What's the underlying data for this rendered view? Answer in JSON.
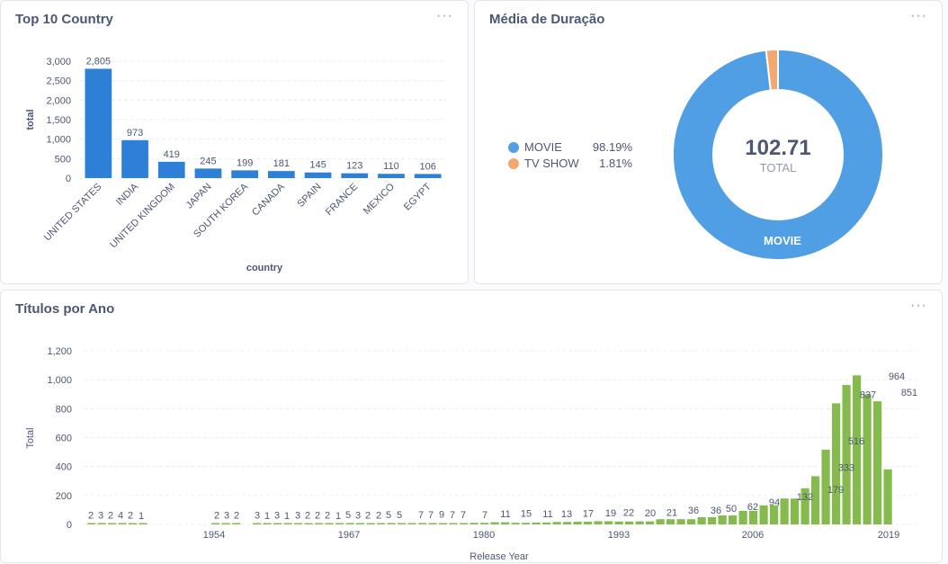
{
  "cards": {
    "top10": {
      "title": "Top 10 Country",
      "menu": "···"
    },
    "duracao": {
      "title": "Média de Duração",
      "menu": "···"
    },
    "titulos": {
      "title": "Títulos por Ano",
      "menu": "···"
    }
  },
  "colors": {
    "bar_blue": "#2e7fd6",
    "bar_green": "#84bb4c",
    "donut_movie": "#509ee3",
    "donut_tv": "#f2a86f"
  },
  "chart_data": [
    {
      "type": "bar",
      "categories": [
        "UNITED STATES",
        "INDIA",
        "UNITED KINGDOM",
        "JAPAN",
        "SOUTH KOREA",
        "CANADA",
        "SPAIN",
        "FRANCE",
        "MEXICO",
        "EGYPT"
      ],
      "values": [
        2805,
        973,
        419,
        245,
        199,
        181,
        145,
        123,
        110,
        106
      ],
      "value_labels": [
        "2,805",
        "973",
        "419",
        "245",
        "199",
        "181",
        "145",
        "123",
        "110",
        "106"
      ],
      "xlabel": "country",
      "ylabel": "total",
      "ylim": [
        0,
        3000
      ],
      "yticks": [
        "0",
        "500",
        "1,000",
        "1,500",
        "2,000",
        "2,500",
        "3,000"
      ],
      "grid": true
    },
    {
      "type": "pie",
      "labels": [
        "MOVIE",
        "TV SHOW"
      ],
      "percent_labels": [
        "98.19%",
        "1.81%"
      ],
      "values": [
        98.19,
        1.81
      ],
      "center_value": "102.71",
      "center_label": "TOTAL",
      "slice_label": "MOVIE",
      "legend_position": "left"
    },
    {
      "type": "bar",
      "x": [
        1942,
        1943,
        1944,
        1945,
        1946,
        1947,
        1954,
        1955,
        1956,
        1958,
        1959,
        1960,
        1961,
        1962,
        1963,
        1964,
        1965,
        1966,
        1967,
        1968,
        1969,
        1970,
        1971,
        1972,
        1973,
        1974,
        1975,
        1976,
        1977,
        1978,
        1979,
        1980,
        1981,
        1982,
        1983,
        1984,
        1985,
        1986,
        1987,
        1988,
        1989,
        1990,
        1991,
        1992,
        1993,
        1994,
        1995,
        1996,
        1997,
        1998,
        1999,
        2000,
        2001,
        2002,
        2003,
        2004,
        2005,
        2006,
        2007,
        2008,
        2009,
        2010,
        2011,
        2012,
        2013,
        2014,
        2015,
        2016,
        2017,
        2018,
        2019,
        2020,
        2021
      ],
      "values": [
        2,
        3,
        2,
        4,
        2,
        1,
        2,
        3,
        2,
        3,
        1,
        3,
        1,
        3,
        2,
        2,
        2,
        1,
        5,
        3,
        2,
        2,
        5,
        5,
        7,
        7,
        9,
        7,
        7,
        7,
        11,
        11,
        15,
        15,
        11,
        11,
        13,
        13,
        17,
        17,
        19,
        19,
        22,
        22,
        20,
        20,
        21,
        21,
        36,
        36,
        36,
        36,
        50,
        50,
        62,
        62,
        94,
        94,
        132,
        132,
        179,
        179,
        250,
        333,
        516,
        837,
        964,
        1030,
        900,
        851,
        381
      ],
      "value_labels": [
        "2",
        "3",
        "2",
        "4",
        "2",
        "1",
        "2",
        "3",
        "2",
        "3",
        "1",
        "3",
        "1",
        "3",
        "2",
        "2",
        "2",
        "1",
        "5",
        "3",
        "2",
        "2",
        "5",
        "5",
        "7",
        "7",
        "9",
        "7",
        "7",
        "7",
        "11",
        "15",
        "11",
        "13",
        "17",
        "19",
        "22",
        "20",
        "21",
        "36",
        "36",
        "50",
        "62",
        "94",
        "132",
        "179",
        "333",
        "516",
        "837",
        "964",
        "851",
        "381"
      ],
      "xticks": [
        "1954",
        "1967",
        "1980",
        "1993",
        "2006",
        "2019"
      ],
      "xlabel": "Release Year",
      "ylabel": "Total",
      "ylim": [
        0,
        1200
      ],
      "yticks": [
        "0",
        "200",
        "400",
        "600",
        "800",
        "1,000",
        "1,200"
      ],
      "grid": true
    }
  ]
}
